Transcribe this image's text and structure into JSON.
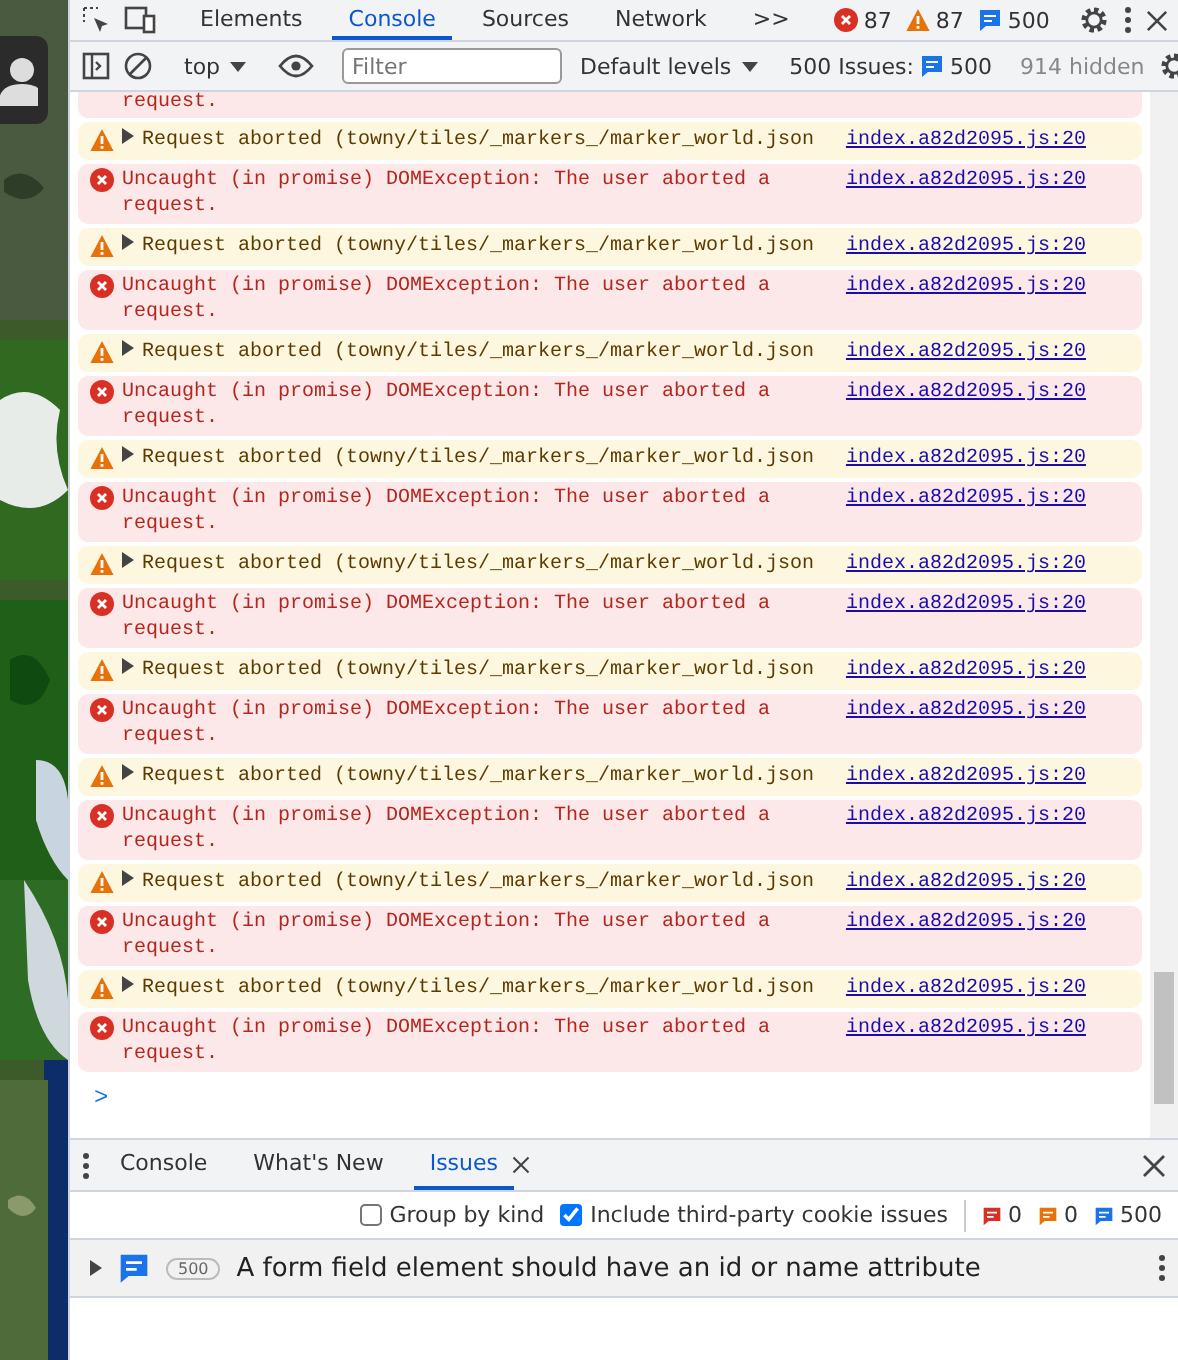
{
  "main_tabs": [
    {
      "label": "Elements",
      "selected": false
    },
    {
      "label": "Console",
      "selected": true
    },
    {
      "label": "Sources",
      "selected": false
    },
    {
      "label": "Network",
      "selected": false
    }
  ],
  "more_tabs": ">>",
  "counts": {
    "errors": "87",
    "warnings": "87",
    "info": "500"
  },
  "console_toolbar": {
    "context": "top",
    "filter_placeholder": "Filter",
    "levels": "Default levels",
    "issues_label": "500 Issues:",
    "issues_count": "500",
    "hidden": "914 hidden"
  },
  "partial_message": {
    "text": "request."
  },
  "messages": [
    {
      "kind": "warning",
      "text": "Request aborted (towny/tiles/_markers_/marker_world.json",
      "source": "index.a82d2095.js:20"
    },
    {
      "kind": "error",
      "text": "Uncaught (in promise) DOMException: The user aborted a request.",
      "source": "index.a82d2095.js:20"
    },
    {
      "kind": "warning",
      "text": "Request aborted (towny/tiles/_markers_/marker_world.json",
      "source": "index.a82d2095.js:20"
    },
    {
      "kind": "error",
      "text": "Uncaught (in promise) DOMException: The user aborted a request.",
      "source": "index.a82d2095.js:20"
    },
    {
      "kind": "warning",
      "text": "Request aborted (towny/tiles/_markers_/marker_world.json",
      "source": "index.a82d2095.js:20"
    },
    {
      "kind": "error",
      "text": "Uncaught (in promise) DOMException: The user aborted a request.",
      "source": "index.a82d2095.js:20"
    },
    {
      "kind": "warning",
      "text": "Request aborted (towny/tiles/_markers_/marker_world.json",
      "source": "index.a82d2095.js:20"
    },
    {
      "kind": "error",
      "text": "Uncaught (in promise) DOMException: The user aborted a request.",
      "source": "index.a82d2095.js:20"
    },
    {
      "kind": "warning",
      "text": "Request aborted (towny/tiles/_markers_/marker_world.json",
      "source": "index.a82d2095.js:20"
    },
    {
      "kind": "error",
      "text": "Uncaught (in promise) DOMException: The user aborted a request.",
      "source": "index.a82d2095.js:20"
    },
    {
      "kind": "warning",
      "text": "Request aborted (towny/tiles/_markers_/marker_world.json",
      "source": "index.a82d2095.js:20"
    },
    {
      "kind": "error",
      "text": "Uncaught (in promise) DOMException: The user aborted a request.",
      "source": "index.a82d2095.js:20"
    },
    {
      "kind": "warning",
      "text": "Request aborted (towny/tiles/_markers_/marker_world.json",
      "source": "index.a82d2095.js:20"
    },
    {
      "kind": "error",
      "text": "Uncaught (in promise) DOMException: The user aborted a request.",
      "source": "index.a82d2095.js:20"
    },
    {
      "kind": "warning",
      "text": "Request aborted (towny/tiles/_markers_/marker_world.json",
      "source": "index.a82d2095.js:20"
    },
    {
      "kind": "error",
      "text": "Uncaught (in promise) DOMException: The user aborted a request.",
      "source": "index.a82d2095.js:20"
    },
    {
      "kind": "warning",
      "text": "Request aborted (towny/tiles/_markers_/marker_world.json",
      "source": "index.a82d2095.js:20"
    },
    {
      "kind": "error",
      "text": "Uncaught (in promise) DOMException: The user aborted a request.",
      "source": "index.a82d2095.js:20"
    }
  ],
  "prompt": ">",
  "drawer_tabs": [
    {
      "label": "Console",
      "selected": false,
      "closable": false
    },
    {
      "label": "What's New",
      "selected": false,
      "closable": false
    },
    {
      "label": "Issues",
      "selected": true,
      "closable": true
    }
  ],
  "issues_toolbar": {
    "group_by_kind": {
      "label": "Group by kind",
      "checked": false
    },
    "third_party": {
      "label": "Include third-party cookie issues",
      "checked": true
    },
    "counts": {
      "errors": "0",
      "warnings": "0",
      "info": "500"
    }
  },
  "issues": [
    {
      "count": "500",
      "text": "A form field element should have an id or name attribute",
      "expanded": false
    }
  ]
}
